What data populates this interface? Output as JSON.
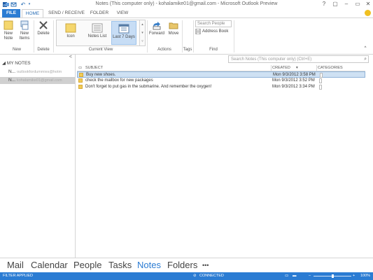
{
  "window": {
    "title": "Notes (This computer only) - kohalamike01@gmail.com - Microsoft Outlook Preview",
    "help": "?",
    "ribbon_options": "▢",
    "minimize": "–",
    "restore": "▭",
    "close": "✕",
    "undo": "↶"
  },
  "tabs": [
    {
      "label": "FILE"
    },
    {
      "label": "HOME"
    },
    {
      "label": "SEND / RECEIVE"
    },
    {
      "label": "FOLDER"
    },
    {
      "label": "VIEW"
    }
  ],
  "ribbon": {
    "new_note": "New Note",
    "new_items": "New Items",
    "delete": "Delete",
    "views": [
      "Icon",
      "Notes List",
      "Last 7 Days"
    ],
    "forward": "Forward",
    "move": "Move",
    "search_people": "Search People",
    "address_book": "Address Book",
    "groups": {
      "new": "New",
      "delete": "Delete",
      "current_view": "Current View",
      "actions": "Actions",
      "tags": "Tags",
      "find": "Find"
    },
    "collapse": "^"
  },
  "nav": {
    "collapse": "<",
    "header": "◢ MY NOTES",
    "folders": [
      {
        "name": "N...",
        "account": "outlookfordummies@hotm"
      },
      {
        "name": "N...",
        "account": "kohalamike01@gmail.com"
      }
    ]
  },
  "search": {
    "placeholder": "Search Notes (This computer only) (Ctrl+E)",
    "icon": "⌕"
  },
  "table": {
    "headers": {
      "subject": "SUBJECT",
      "created": "CREATED",
      "categories": "CATEGORIES"
    },
    "rows": [
      {
        "subject": "Buy new shoes.",
        "created": "Mon 9/3/2012 3:58 PM"
      },
      {
        "subject": "check the mailbox for new packages",
        "created": "Mon 9/3/2012 3:52 PM"
      },
      {
        "subject": "Don't forget to put gas in the submarine.  And remember the oxygen!",
        "created": "Mon 9/3/2012 3:34 PM"
      }
    ]
  },
  "bottom_nav": [
    "Mail",
    "Calendar",
    "People",
    "Tasks",
    "Notes",
    "Folders",
    "•••"
  ],
  "status": {
    "filter": "FILTER APPLIED",
    "connection": "CONNECTED",
    "zoom": "100%",
    "zoom_level": 1.0
  },
  "colors": {
    "accent": "#2b7cd3",
    "selection": "#cfe1f3"
  }
}
